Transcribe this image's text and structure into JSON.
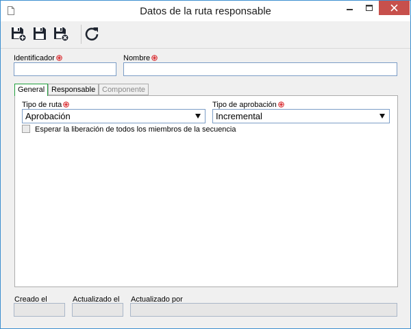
{
  "window": {
    "title": "Datos de la ruta responsable"
  },
  "toolbar": {
    "icons": [
      "save-new-icon",
      "save-icon",
      "save-close-icon",
      "refresh-icon"
    ]
  },
  "form": {
    "identificador_label": "Identificador",
    "identificador_value": "",
    "nombre_label": "Nombre",
    "nombre_value": ""
  },
  "tabs": [
    {
      "label": "General",
      "active": true,
      "enabled": true
    },
    {
      "label": "Responsable",
      "active": false,
      "enabled": true
    },
    {
      "label": "Componente",
      "active": false,
      "enabled": false
    }
  ],
  "general": {
    "tipo_ruta_label": "Tipo de ruta",
    "tipo_ruta_value": "Aprobación",
    "tipo_aprobacion_label": "Tipo de aprobación",
    "tipo_aprobacion_value": "Incremental",
    "esperar_label": "Esperar la liberación de todos los miembros de la secuencia",
    "esperar_checked": false
  },
  "footer": {
    "creado_label": "Creado el",
    "creado_value": "",
    "actualizado_label": "Actualizado el",
    "actualizado_value": "",
    "actualizado_por_label": "Actualizado por",
    "actualizado_por_value": ""
  },
  "colors": {
    "window_border": "#3c8fd0",
    "close_button": "#c7504c",
    "required_marker": "#d9262b",
    "active_tab_border": "#1f9e3b"
  }
}
